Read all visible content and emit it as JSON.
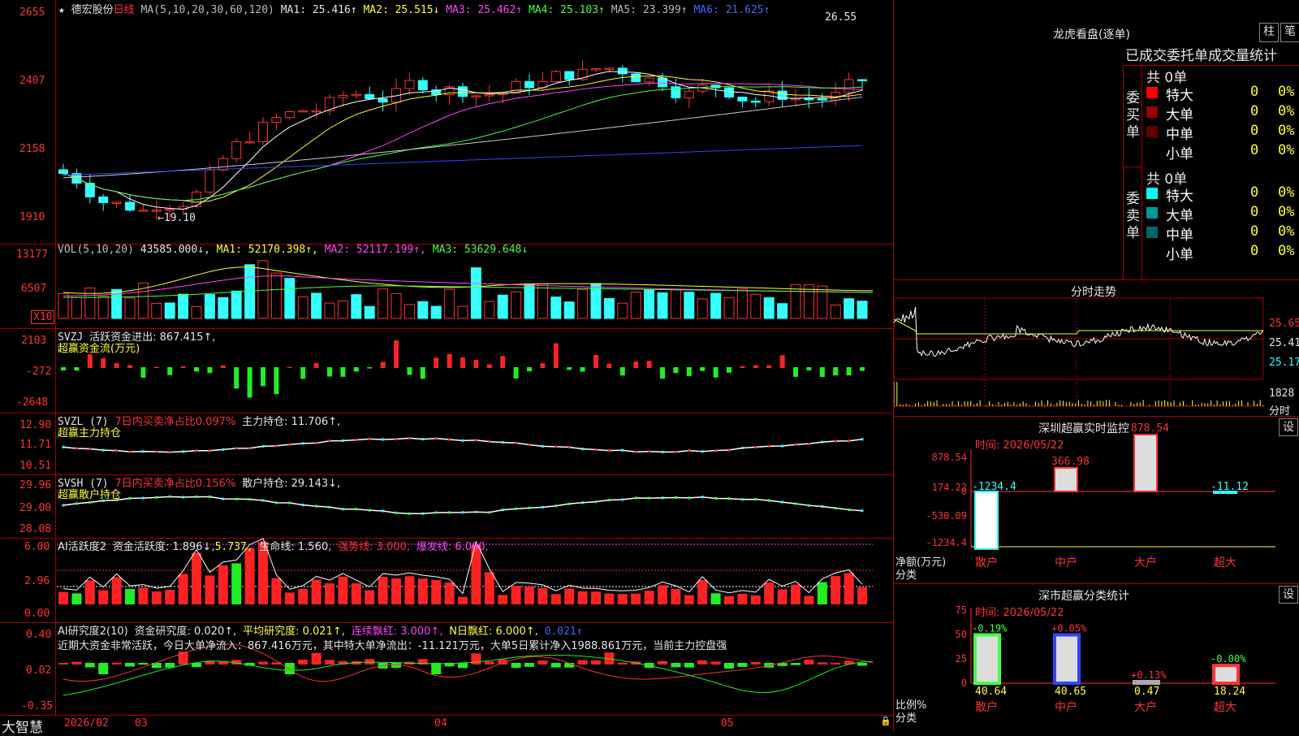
{
  "main": {
    "header": {
      "star": "★",
      "name": "德宏股份",
      "period": "日线",
      "ma_def": "MA(5,10,20,30,60,120)",
      "ma": [
        {
          "label": "MA1: 25.416↑",
          "color": "#ffffff"
        },
        {
          "label": "MA2: 25.515↓",
          "color": "#ffff33"
        },
        {
          "label": "MA3: 25.462↑",
          "color": "#ff44ff"
        },
        {
          "label": "MA4: 25.103↑",
          "color": "#44ff44"
        },
        {
          "label": "MA5: 23.399↑",
          "color": "#cccccc"
        },
        {
          "label": "MA6: 21.625↑",
          "color": "#3344ff"
        }
      ]
    },
    "yticks": [
      "2655",
      "2407",
      "2158",
      "1910"
    ],
    "high_label": "26.55",
    "low_label": "19.10"
  },
  "vol": {
    "header": "VOL(5,10,20)",
    "v": "43585.000↓,",
    "ma1": "MA1: 52170.398↑,",
    "ma2": "MA2: 52117.199↑,",
    "ma3": "MA3: 53629.648↓",
    "yticks": [
      "13177",
      "6507"
    ],
    "unit": "X10"
  },
  "svzj": {
    "name": "SVZJ",
    "title": "活跃资金进出: 867.415↑,",
    "sub": "超赢资金流(万元)",
    "yticks": [
      "2103",
      "-272",
      "-2648"
    ]
  },
  "svzl": {
    "name": "SVZL (7)",
    "ratio": "7日内买卖净占比0.097%",
    "hold": "主力持仓: 11.706↑,",
    "sub": "超赢主力持仓",
    "yticks": [
      "12.90",
      "11.71",
      "10.51"
    ]
  },
  "svsh": {
    "name": "SVSH (7)",
    "ratio": "7日内买卖净占比0.156%",
    "hold": "散户持仓: 29.143↓,",
    "sub": "超赢散户持仓",
    "yticks": [
      "29.96",
      "29.00",
      "28.08"
    ]
  },
  "ai1": {
    "name": "AI活跃度2",
    "a": "资金活跃度: 1.896↓,",
    "b": "5.737,",
    "c": "生命线: 1.560,",
    "d": "强势线: 3.000,",
    "e": "爆发线: 6.000,",
    "yticks": [
      "6.00",
      "2.96",
      "0.00"
    ]
  },
  "ai2": {
    "name": "AI研究度2(10)",
    "a": "资金研究度: 0.020↑,",
    "b": "平均研究度: 0.021↑,",
    "c": "连续飘红: 3.000↑,",
    "d": "N日飘红: 6.000↑,",
    "e": "0.021↑",
    "msg": "近期大资金非常活跃，今日大单净流入：867.416万元，其中特大单净流出：-11.121万元，大单5日累计净入1988.861万元，当前主力控盘强",
    "yticks": [
      "0.40",
      "0.02",
      "-0.35"
    ]
  },
  "xaxis": {
    "brand": "大智慧",
    "labels": [
      "2026/02",
      "03",
      "04",
      "05"
    ]
  },
  "lhb": {
    "title": "龙虎看盘(逐单)",
    "btn1": "柱",
    "btn2": "笔",
    "tabs": "已成交委托单成交量统计",
    "buy": {
      "side": "委买单",
      "total": "共 0单",
      "rows": [
        {
          "name": "特大",
          "count": "0",
          "pct": "0%",
          "color": "#ff0000"
        },
        {
          "name": "大单",
          "count": "0",
          "pct": "0%",
          "color": "#990000"
        },
        {
          "name": "中单",
          "count": "0",
          "pct": "0%",
          "color": "#660000"
        },
        {
          "name": "小单",
          "count": "0",
          "pct": "0%",
          "color": "#000000"
        }
      ]
    },
    "sell": {
      "side": "委卖单",
      "total": "共 0单",
      "rows": [
        {
          "name": "特大",
          "count": "0",
          "pct": "0%",
          "color": "#00ffff"
        },
        {
          "name": "大单",
          "count": "0",
          "pct": "0%",
          "color": "#009999"
        },
        {
          "name": "中单",
          "count": "0",
          "pct": "0%",
          "color": "#006666"
        },
        {
          "name": "小单",
          "count": "0",
          "pct": "0%",
          "color": "#000000"
        }
      ]
    }
  },
  "fs": {
    "title": "分时走势",
    "yticks": [
      "25.65",
      "25.41",
      "25.17"
    ],
    "vol": "1828",
    "vol_unit": "分时"
  },
  "sz_monitor": {
    "title": "深圳超赢实时监控",
    "btn": "设",
    "time": "时间: 2026/05/22",
    "yticks": [
      "878.54",
      "174.22",
      "0",
      "-530.09",
      "-1234.4"
    ],
    "ylabel": "净额(万元)",
    "xlabel": "分类",
    "bars": [
      {
        "name": "散户",
        "value": -1234.4,
        "label": "-1234.4"
      },
      {
        "name": "中户",
        "value": 366.98,
        "label": "366.98"
      },
      {
        "name": "大户",
        "value": 878.54,
        "label": "878.54"
      },
      {
        "name": "超大",
        "value": -11.12,
        "label": "-11.12"
      }
    ]
  },
  "sz_class": {
    "title": "深市超赢分类统计",
    "btn": "设",
    "time": "时间: 2026/05/22",
    "yticks": [
      "75",
      "50",
      "25",
      "0"
    ],
    "ylabel": "比例%",
    "xlabel": "分类",
    "bars": [
      {
        "name": "散户",
        "value": 40.64,
        "label": "40.64",
        "delta": "-0.19%",
        "color": "#44ff44"
      },
      {
        "name": "中户",
        "value": 40.65,
        "label": "40.65",
        "delta": "+0.05%",
        "color": "#3344ff"
      },
      {
        "name": "大户",
        "value": 0.47,
        "label": "0.47",
        "delta": "+0.13%",
        "color": "#aaaaaa"
      },
      {
        "name": "超大",
        "value": 18.24,
        "label": "18.24",
        "delta": "-0.00%",
        "color": "#ff3333"
      }
    ]
  }
}
